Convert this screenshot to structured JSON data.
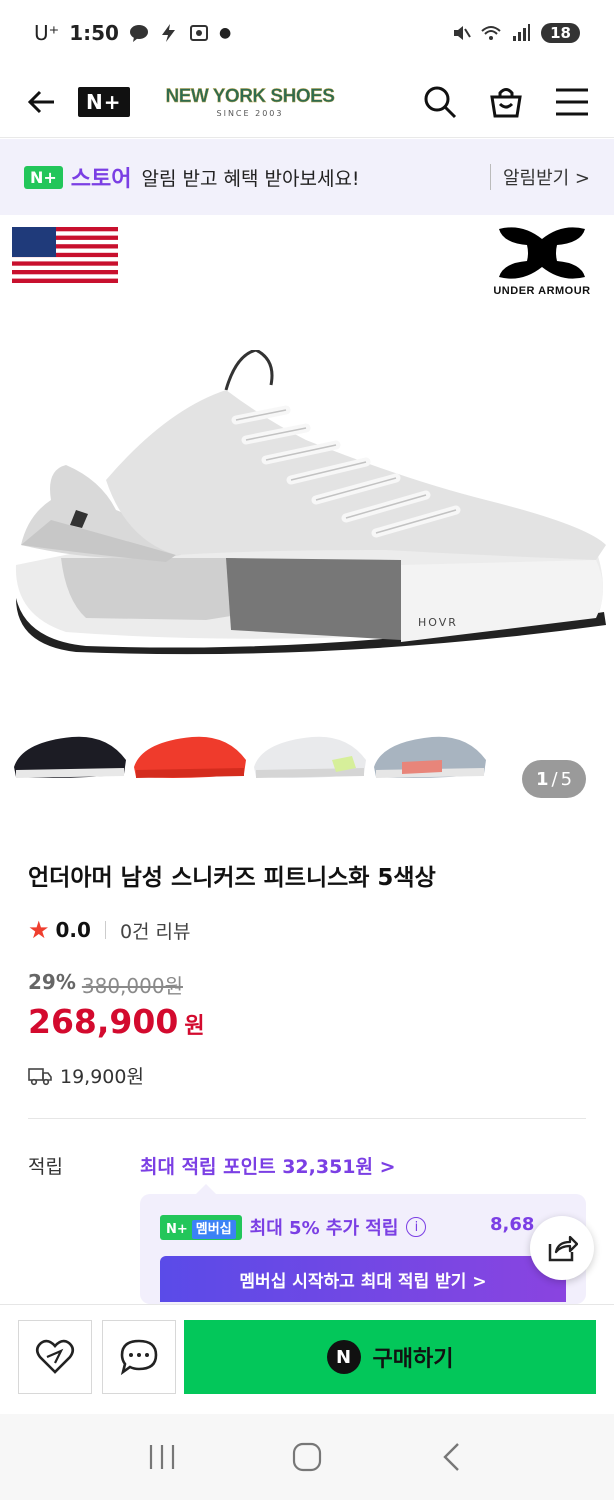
{
  "status_bar": {
    "carrier": "U⁺",
    "time": "1:50",
    "battery": "18"
  },
  "header": {
    "brand_logo": "N+",
    "store_name": "NEW YORK SHOES",
    "store_since": "SINCE 2003",
    "icons": [
      "back-arrow-icon",
      "search-icon",
      "shopping-bag-icon",
      "menu-icon"
    ]
  },
  "notice": {
    "badge": "N+",
    "store_word": "스토어",
    "text": "알림 받고 혜택 받아보세요!",
    "link": "알림받기 >"
  },
  "hero": {
    "brand": "UNDER ARMOUR",
    "shoe_label": "HOVR"
  },
  "gallery": {
    "current": "1",
    "separator": "/",
    "total": "5",
    "thumb_colors": [
      "#1c1c24",
      "#ef3b2c",
      "#e9eaec",
      "#a8b4c0"
    ]
  },
  "product": {
    "title": "언더아머 남성 스니커즈 피트니스화 5색상",
    "rating": "0.0",
    "review_count": "0건 리뷰",
    "discount_rate": "29%",
    "original_price": "380,000원",
    "price": "268,900",
    "currency": "원",
    "shipping_fee": "19,900원"
  },
  "points": {
    "label": "적립",
    "max_text": "최대 적립 포인트 32,351원 >",
    "member_badge": "N+",
    "member_badge_label": "멤버십",
    "member_text": "최대 5% 추가 적립",
    "member_amount": "8,68",
    "member_cta": "멤버십 시작하고 최대 적립 받기 >"
  },
  "bottom_bar": {
    "buy_logo": "N",
    "buy_label": "구매하기"
  },
  "colors": {
    "accent_purple": "#7b3fe4",
    "price_red": "#d30a2e",
    "buy_green": "#03c75a"
  }
}
